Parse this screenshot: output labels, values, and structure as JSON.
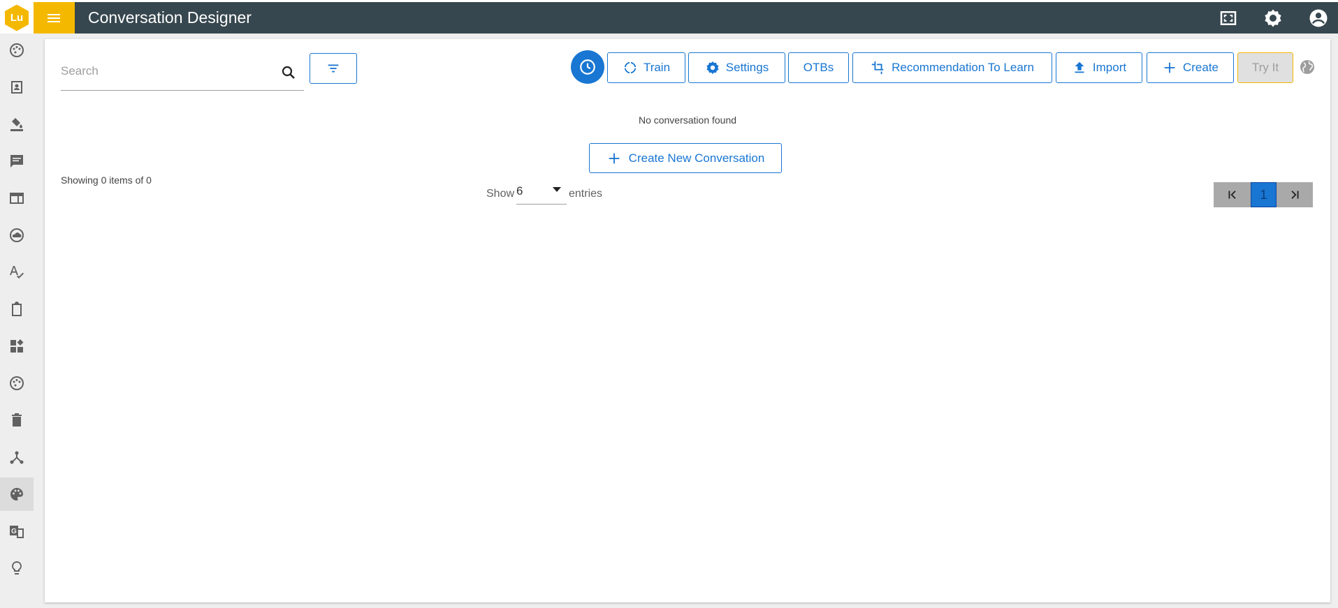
{
  "header": {
    "logo_text": "Lu",
    "title": "Conversation Designer",
    "icons": [
      "fullscreen-icon",
      "settings-icon",
      "account-circle-icon"
    ],
    "colors": {
      "bar": "#37474f",
      "accent": "#f5b800"
    }
  },
  "sidebar": {
    "items": [
      {
        "icon": "palette-dots-icon"
      },
      {
        "icon": "contact-card-icon"
      },
      {
        "icon": "paint-bucket-icon"
      },
      {
        "icon": "chat-icon"
      },
      {
        "icon": "web-panel-icon"
      },
      {
        "icon": "cloud-icon"
      },
      {
        "icon": "spellcheck-icon"
      },
      {
        "icon": "clipboard-icon"
      },
      {
        "icon": "widgets-icon"
      },
      {
        "icon": "palette-dots-icon"
      },
      {
        "icon": "trash-icon"
      },
      {
        "icon": "hub-icon"
      },
      {
        "icon": "palette-icon",
        "active": true
      },
      {
        "icon": "translate-icon"
      },
      {
        "icon": "lightbulb-icon"
      }
    ]
  },
  "search": {
    "placeholder": "Search"
  },
  "toolbar": {
    "train_label": "Train",
    "settings_label": "Settings",
    "otbs_label": "OTBs",
    "recommendation_label": "Recommendation To Learn",
    "import_label": "Import",
    "create_label": "Create",
    "tryit_label": "Try It"
  },
  "content": {
    "empty_message": "No conversation found",
    "create_new_label": "Create New Conversation",
    "showing_text": "Showing 0 items of 0"
  },
  "pagination": {
    "show_label": "Show",
    "entries_value": "6",
    "entries_label": "entries",
    "current_page": "1"
  },
  "colors": {
    "primary": "#1976d2",
    "disabled": "#e0e0e0"
  }
}
